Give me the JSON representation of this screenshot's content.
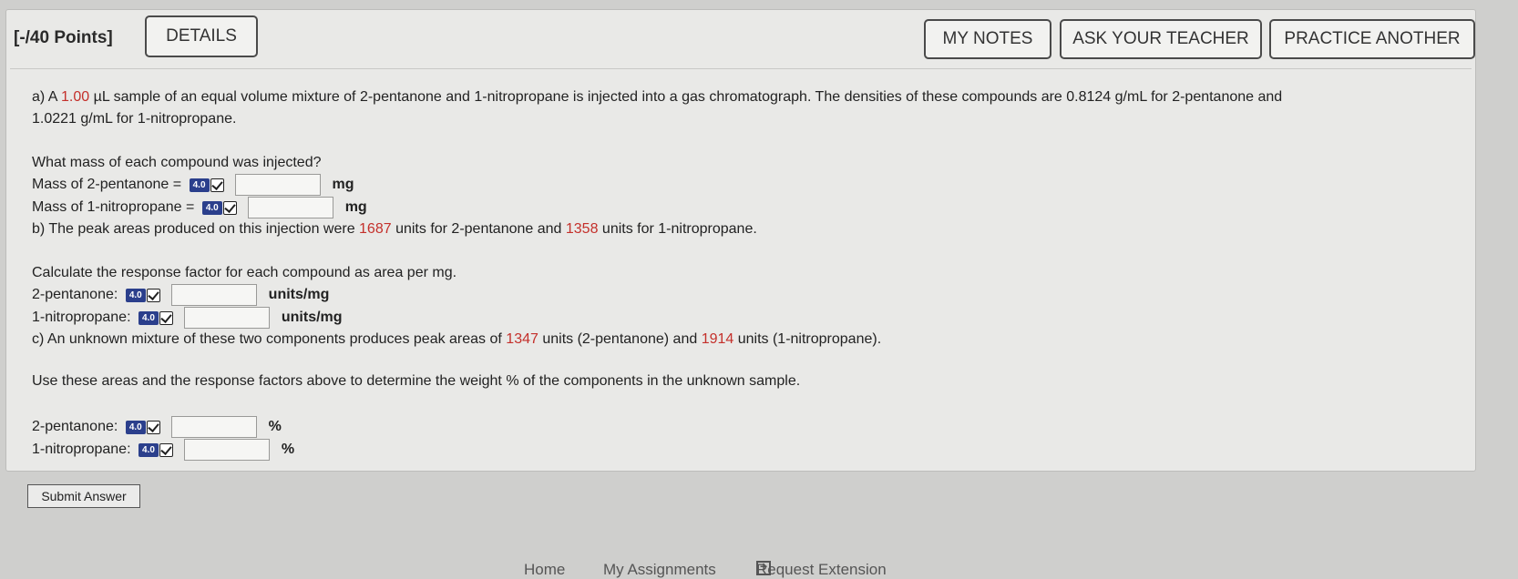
{
  "header": {
    "points": "[-/40 Points]",
    "details": "DETAILS",
    "my_notes": "MY NOTES",
    "ask_teacher": "ASK YOUR TEACHER",
    "practice_another": "PRACTICE ANOTHER"
  },
  "part_a": {
    "line1_a": "a) A ",
    "line1_vol": "1.00",
    "line1_b": " µL sample of an equal volume mixture of 2-pentanone and 1-nitropropane is injected into a gas chromatograph. The densities of these compounds are 0.8124 g/mL for 2-pentanone and",
    "line2": "1.0221 g/mL for 1-nitropropane.",
    "question": "What mass of each compound was injected?",
    "mass_pentanone_label": "Mass of 2-pentanone =",
    "mass_nitro_label": "Mass of 1-nitropropane =",
    "unit": "mg"
  },
  "part_b": {
    "line_a": "b) The peak areas produced on this injection were ",
    "area1": "1687",
    "line_b": " units for 2-pentanone and ",
    "area2": "1358",
    "line_c": " units for 1-nitropropane.",
    "question": "Calculate the response factor for each compound as area per mg.",
    "pentanone_label": "2-pentanone:",
    "nitro_label": "1-nitropropane:",
    "unit": "units/mg"
  },
  "part_c": {
    "line_a": "c) An unknown mixture of these two components produces peak areas of ",
    "area1": "1347",
    "line_b": " units (2-pentanone) and ",
    "area2": "1914",
    "line_c": " units (1-nitropropane).",
    "question": "Use these areas and the response factors above to determine the weight % of the components in the unknown sample.",
    "pentanone_label": "2-pentanone:",
    "nitro_label": "1-nitropropane:",
    "unit": "%"
  },
  "badge_text": "4.0",
  "submit": "Submit Answer",
  "footer": {
    "home": "Home",
    "assignments": "My Assignments",
    "extension": "Request Extension"
  }
}
